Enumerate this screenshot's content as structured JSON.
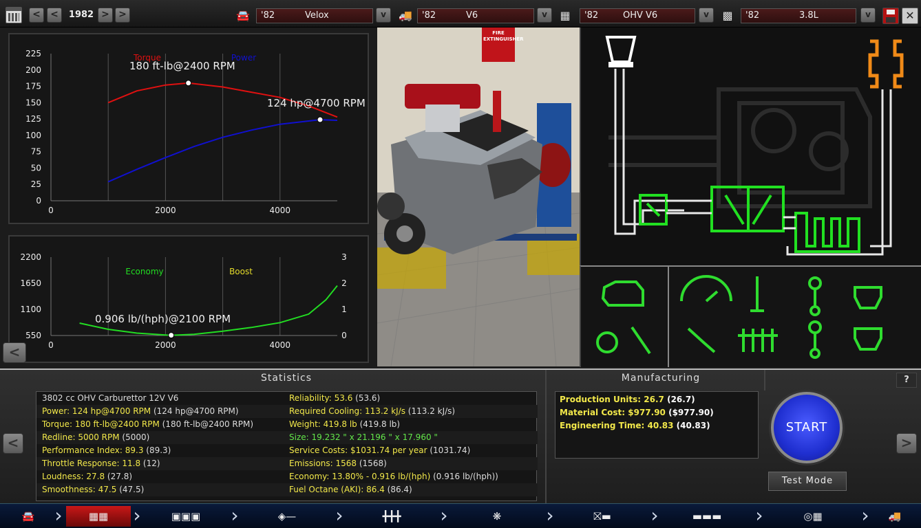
{
  "topbar": {
    "year": "1982",
    "selectors": [
      {
        "year": "'82",
        "value": "Velox",
        "icon": "car-icon"
      },
      {
        "year": "'82",
        "value": "V6",
        "icon": "car-front-icon"
      },
      {
        "year": "'82",
        "value": "OHV V6",
        "icon": "engine-block-icon"
      },
      {
        "year": "'82",
        "value": "3.8L",
        "icon": "piston-icon"
      }
    ],
    "prev": "<",
    "first": "<",
    "next": ">",
    "last": ">",
    "dropdown": "v"
  },
  "torque_chart_data": {
    "type": "line",
    "x_ticks": [
      "0",
      "2000",
      "4000"
    ],
    "y_ticks": [
      "0",
      "25",
      "50",
      "75",
      "100",
      "125",
      "150",
      "175",
      "200",
      "225"
    ],
    "xlim": [
      0,
      5000
    ],
    "ylim": [
      0,
      225
    ],
    "grid": true,
    "legend": [
      "Torque",
      "Power"
    ],
    "series": [
      {
        "name": "Torque",
        "color": "#e01010",
        "x": [
          1000,
          1500,
          2000,
          2400,
          3000,
          3500,
          4000,
          4500,
          5000
        ],
        "values": [
          150,
          168,
          177,
          180,
          174,
          166,
          158,
          145,
          128
        ]
      },
      {
        "name": "Power",
        "color": "#1010d0",
        "x": [
          1000,
          1500,
          2000,
          2500,
          3000,
          3500,
          4000,
          4500,
          4700,
          5000
        ],
        "values": [
          29,
          48,
          66,
          83,
          97,
          108,
          117,
          122,
          124,
          123
        ]
      }
    ],
    "annotations": [
      {
        "text": "180 ft-lb@2400 RPM",
        "x": 2400,
        "y": 180
      },
      {
        "text": "124 hp@4700 RPM",
        "x": 4700,
        "y": 124
      }
    ]
  },
  "economy_chart_data": {
    "type": "line",
    "x_ticks": [
      "0",
      "2000",
      "4000"
    ],
    "y_left_ticks": [
      "550",
      "1100",
      "1650",
      "2200"
    ],
    "y_right_ticks": [
      "0",
      "1",
      "2",
      "3"
    ],
    "xlim": [
      0,
      5000
    ],
    "ylim": [
      550,
      2200
    ],
    "grid": true,
    "legend": [
      "Economy",
      "Boost"
    ],
    "series": [
      {
        "name": "Economy",
        "color": "#22dd22",
        "x": [
          500,
          1000,
          1500,
          2000,
          2100,
          2500,
          3000,
          3500,
          4000,
          4500,
          4800,
          5000
        ],
        "values": [
          810,
          680,
          600,
          560,
          555,
          575,
          640,
          720,
          820,
          1000,
          1300,
          1600
        ]
      }
    ],
    "annotations": [
      {
        "text": "0.906 lb/(hph)@2100 RPM",
        "x": 2100,
        "y": 555
      }
    ]
  },
  "view3d": {
    "sign": "FIRE EXTINGUISHER"
  },
  "stats": {
    "title": "Statistics",
    "left": [
      {
        "label": "3802 cc OHV Carburettor 12V V6",
        "value": "",
        "style": "w"
      },
      {
        "label": "Power: 124 hp@4700 RPM",
        "value": "(124 hp@4700 RPM)",
        "style": "y"
      },
      {
        "label": "Torque: 180 ft-lb@2400 RPM",
        "value": "(180 ft-lb@2400 RPM)",
        "style": "y"
      },
      {
        "label": "Redline: 5000 RPM",
        "value": "(5000)",
        "style": "y"
      },
      {
        "label": "Performance Index: 89.3",
        "value": "(89.3)",
        "style": "y"
      },
      {
        "label": "Throttle Response: 11.8",
        "value": "(12)",
        "style": "y"
      },
      {
        "label": "Loudness: 27.8",
        "value": "(27.8)",
        "style": "y"
      },
      {
        "label": "Smoothness: 47.5",
        "value": "(47.5)",
        "style": "y"
      }
    ],
    "right": [
      {
        "label": "Reliability: 53.6",
        "value": "(53.6)",
        "style": "y"
      },
      {
        "label": "Required Cooling: 113.2 kJ/s",
        "value": "(113.2 kJ/s)",
        "style": "y"
      },
      {
        "label": "Weight: 419.8 lb",
        "value": "(419.8 lb)",
        "style": "y"
      },
      {
        "label": "Size: 19.232 \" x 21.196 \" x 17.960 \"",
        "value": "",
        "style": "g"
      },
      {
        "label": "Service Costs: $1031.74 per year",
        "value": "(1031.74)",
        "style": "y"
      },
      {
        "label": "Emissions: 1568",
        "value": "(1568)",
        "style": "y"
      },
      {
        "label": "Economy: 13.80% - 0.916 lb/(hph)",
        "value": "(0.916 lb/(hph))",
        "style": "y"
      },
      {
        "label": "Fuel Octane (AKI): 86.4",
        "value": "(86.4)",
        "style": "y"
      }
    ]
  },
  "manufacturing": {
    "title": "Manufacturing",
    "rows": [
      {
        "label": "Production Units: 26.7",
        "value": "(26.7)"
      },
      {
        "label": "Material Cost: $977.90",
        "value": "($977.90)"
      },
      {
        "label": "Engineering Time: 40.83",
        "value": "(40.83)"
      }
    ]
  },
  "controls": {
    "start": "START",
    "test_mode": "Test Mode",
    "help": "?",
    "back": "<",
    "forward": ">"
  },
  "tabs": [
    "car-icon",
    "engine-block-icon",
    "block-icon",
    "crank-icon",
    "valvetrain-icon",
    "turbo-icon",
    "fuel-icon",
    "exhaust-icon",
    "gauge-icon",
    "truck-icon"
  ]
}
